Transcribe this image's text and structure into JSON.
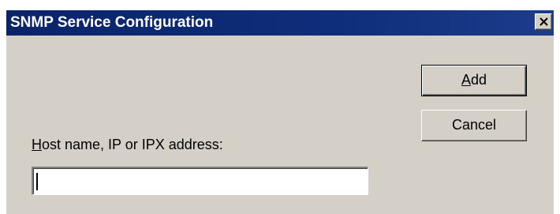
{
  "window": {
    "title": "SNMP Service Configuration",
    "close_icon": "close-icon"
  },
  "buttons": {
    "add": {
      "mnemonic": "A",
      "rest": "dd"
    },
    "cancel": "Cancel"
  },
  "field": {
    "label_mnemonic": "H",
    "label_rest": "ost name, IP or IPX address:",
    "value": ""
  },
  "colors": {
    "titlebar": "#0a246a",
    "dialog_bg": "#d4d0c8",
    "title_text": "#ffffff"
  }
}
